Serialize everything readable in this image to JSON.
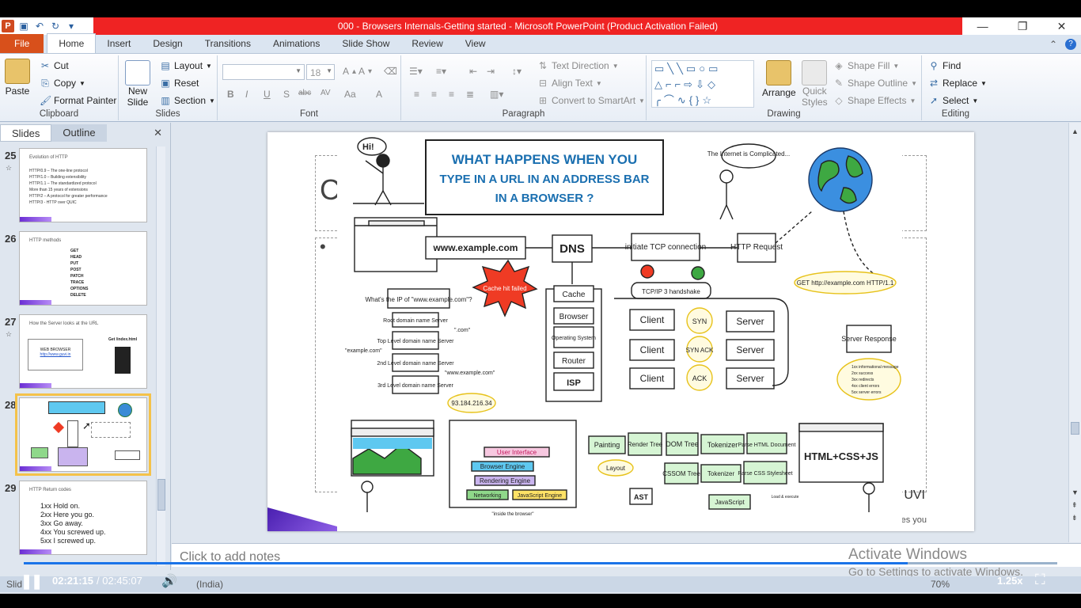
{
  "window": {
    "title": "000 - Browsers Internals-Getting started  -  Microsoft PowerPoint (Product Activation Failed)"
  },
  "ribbon_tabs": [
    "File",
    "Home",
    "Insert",
    "Design",
    "Transitions",
    "Animations",
    "Slide Show",
    "Review",
    "View"
  ],
  "clipboard": {
    "paste": "Paste",
    "cut": "Cut",
    "copy": "Copy",
    "format_painter": "Format Painter",
    "label": "Clipboard"
  },
  "slides_group": {
    "new_slide_1": "New",
    "new_slide_2": "Slide",
    "layout": "Layout",
    "reset": "Reset",
    "section": "Section",
    "label": "Slides"
  },
  "font_group": {
    "size": "18",
    "label": "Font",
    "bold": "B",
    "italic": "I",
    "underline": "U",
    "shadow": "S",
    "strike": "abc",
    "spacing": "AV",
    "case": "Aa",
    "color": "A"
  },
  "paragraph_group": {
    "text_direction": "Text Direction",
    "align_text": "Align Text",
    "smartart": "Convert to SmartArt",
    "label": "Paragraph"
  },
  "drawing_group": {
    "arrange": "Arrange",
    "quick_styles_1": "Quick",
    "quick_styles_2": "Styles",
    "shape_fill": "Shape Fill",
    "shape_outline": "Shape Outline",
    "shape_effects": "Shape Effects",
    "label": "Drawing"
  },
  "editing_group": {
    "find": "Find",
    "replace": "Replace",
    "select": "Select",
    "label": "Editing"
  },
  "panel": {
    "tab_slides": "Slides",
    "tab_outline": "Outline"
  },
  "thumbnails": [
    {
      "num": "25",
      "title": "Evolution of HTTP",
      "lines": [
        "HTTP/0.9 – The one-line protocol",
        "HTTP/1.0 – Building extensibility",
        "HTTP/1.1 – The standardized protocol",
        "More than 15 years of extensions",
        "HTTP/2 – A protocol for greater performance",
        "HTTP/3 - HTTP over QUIC"
      ]
    },
    {
      "num": "26",
      "title": "HTTP methods",
      "lines": [
        "GET",
        "HEAD",
        "PUT",
        "POST",
        "PATCH",
        "TRACE",
        "OPTIONS",
        "DELETE"
      ]
    },
    {
      "num": "27",
      "title": "How the Server looks at the URL",
      "lines": [
        "WEB BROWSER",
        "http://www.guvi.in",
        "Get /index.html"
      ]
    },
    {
      "num": "28",
      "title": "",
      "lines": []
    },
    {
      "num": "29",
      "title": "HTTP Return codes",
      "lines": [
        "1xx Hold on.",
        "2xx Here you go.",
        "3xx Go away.",
        "4xx You screwed up.",
        "5xx I screwed up."
      ]
    }
  ],
  "slide": {
    "bg_letter_1": "C",
    "bg_bullet": "•",
    "brand_text": "UVI",
    "brand_tagline": "deserves you",
    "diagram": {
      "hi": "Hi!",
      "heading_1": "WHAT HAPPENS WHEN YOU",
      "heading_2": "TYPE IN A URL IN AN ADDRESS BAR",
      "heading_3": "IN A BROWSER ?",
      "internet_note": "The Internet is Complicated...",
      "url": "www.example.com",
      "dns": "DNS",
      "tcp": "initiate TCP connection",
      "http_request": "HTTP Request",
      "get_line": "GET http://example.com HTTP/1.1",
      "cache_failed": "Cache hit failed",
      "what_ip": "What's the IP of \"www.example.com\"?",
      "root_server": "Root domain name Server",
      "com": "\".com\"",
      "example_com": "\"example.com\"",
      "tld_server": "Top Level domain name Server",
      "second_level": "2nd Level domain name Server",
      "third_level": "3rd Level domain name Server",
      "www_example": "\"www.example.com\"",
      "ip": "93.184.216.34",
      "cache": "Cache",
      "browser": "Browser",
      "os": "Operating System",
      "router": "Router",
      "isp": "ISP",
      "handshake": "TCP/IP 3 handshake",
      "client": "Client",
      "server": "Server",
      "syn": "SYN",
      "synack": "SYN ACK",
      "ack": "ACK",
      "server_response": "Server Response",
      "codes": [
        "1xx informational message",
        "2xx success",
        "3xx redirects",
        "4xx client errors",
        "5xx server errors"
      ],
      "painting": "Painting",
      "render_tree": "Render Tree",
      "dom_tree": "DOM Tree",
      "tokenizer": "Tokenizer",
      "parse_html": "Parse HTML Document",
      "layout": "Layout",
      "cssom": "CSSOM Tree",
      "tokenizer2": "Tokenizer",
      "parse_css": "Parse CSS Stylesheet",
      "html_css_js": "HTML+CSS+JS",
      "javascript": "JavaScript",
      "ast": "AST",
      "load_execute": "Load & execute",
      "ui": "User Interface",
      "browser_engine": "Browser Engine",
      "rendering_engine": "Rendering Engine",
      "networking": "Networking",
      "js_engine": "JavaScript Engine",
      "inside_browser": "\"inside the browser\""
    }
  },
  "notes_placeholder": "Click to add notes",
  "activation": {
    "line1": "Activate Windows",
    "line2": "Go to Settings to activate Windows."
  },
  "status": {
    "slide": "Slid",
    "lang": "(India)",
    "zoom": "70%"
  },
  "video": {
    "current": "02:21:15",
    "separator": "/",
    "duration": "02:45:07",
    "speed": "1.25x",
    "progress": 0.855
  },
  "colors": {
    "title_bar": "#ef2323",
    "file_tab": "#d8501b",
    "selected_thumb": "#f4c24a",
    "progress": "#1a73e8"
  }
}
